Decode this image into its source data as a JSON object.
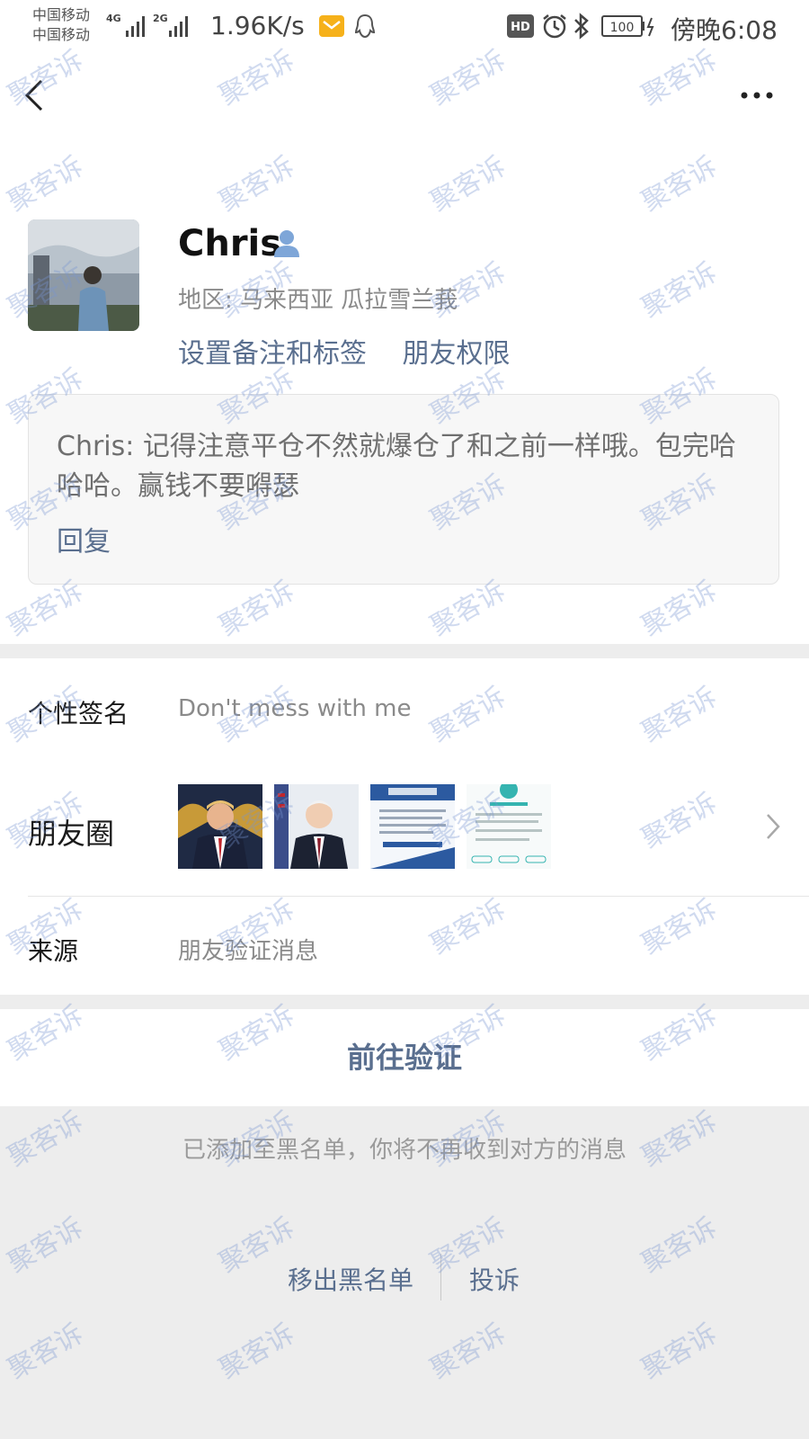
{
  "status": {
    "carrier1": "中国移动",
    "carrier2": "中国移动",
    "net1": "4G",
    "net2": "2G",
    "speed": "1.96K/s",
    "hd": "HD",
    "battery": "100",
    "time": "傍晚6:08"
  },
  "profile": {
    "name": "Chris",
    "region": "地区: 马来西亚  瓜拉雪兰莪",
    "set_remark": "设置备注和标签",
    "friend_permission": "朋友权限"
  },
  "moment": {
    "text": "Chris: 记得注意平仓不然就爆仓了和之前一样哦。包完哈哈哈。赢钱不要嘚瑟",
    "reply": "回复"
  },
  "info": {
    "signature_label": "个性签名",
    "signature_value": "Don't mess with me",
    "moments_label": "朋友圈",
    "source_label": "来源",
    "source_value": "朋友验证消息"
  },
  "verify_button": "前往验证",
  "blacklist": {
    "note": "已添加至黑名单，你将不再收到对方的消息",
    "remove": "移出黑名单",
    "complain": "投诉"
  },
  "watermark": "聚客诉",
  "colors": {
    "link": "#5a6f8f",
    "gray_text": "#8a8a8a",
    "separator": "#ededed",
    "watermark": "#7896d2"
  }
}
